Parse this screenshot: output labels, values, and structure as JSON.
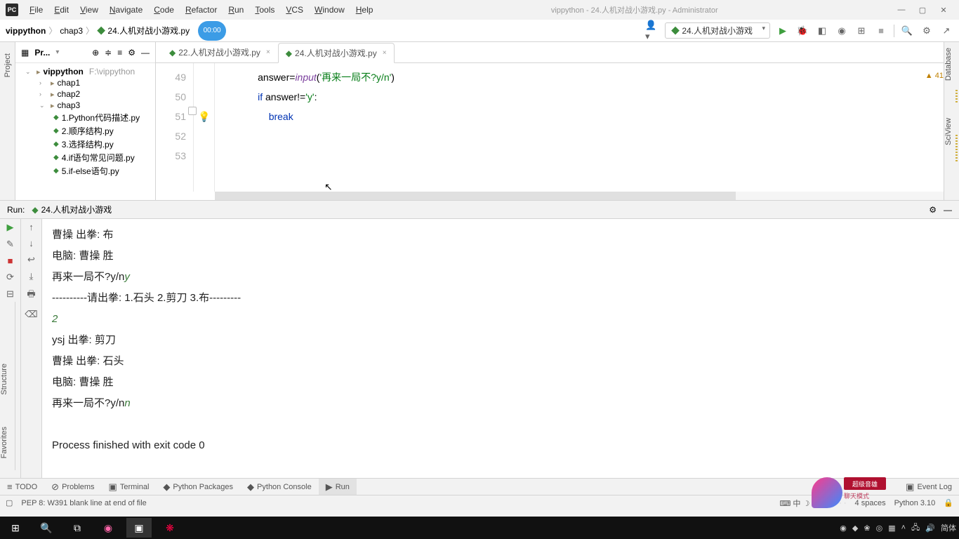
{
  "window": {
    "title": "vippython - 24.人机对战小游戏.py - Administrator",
    "app_icon": "PC"
  },
  "menu": [
    "File",
    "Edit",
    "View",
    "Navigate",
    "Code",
    "Refactor",
    "Run",
    "Tools",
    "VCS",
    "Window",
    "Help"
  ],
  "breadcrumb": [
    "vippython",
    "chap3",
    "24.人机对战小游戏.py"
  ],
  "timer": "00:00",
  "run_config": "24.人机对战小游戏",
  "project": {
    "panel_title": "Pr...",
    "root": "vippython",
    "root_path": "F:\\vippython",
    "folders": [
      "chap1",
      "chap2",
      "chap3"
    ],
    "files": [
      "1.Python代码描述.py",
      "2.顺序结构.py",
      "3.选择结构.py",
      "4.if语句常见问题.py",
      "5.if-else语句.py"
    ]
  },
  "tabs": [
    {
      "name": "22.人机对战小游戏.py",
      "active": false
    },
    {
      "name": "24.人机对战小游戏.py",
      "active": true
    }
  ],
  "code": {
    "lines": [
      {
        "n": 49,
        "indent": "        ",
        "html": "answer=<span class='fn'>input</span>(<span class='str'>'再来一局不?y/n'</span>)"
      },
      {
        "n": 50,
        "indent": "        ",
        "html": "<span class='kw'>if</span> answer!=<span class='str'>'y'</span>:"
      },
      {
        "n": 51,
        "indent": "            ",
        "html": "<span class='kw'>break</span>"
      },
      {
        "n": 52,
        "indent": "",
        "html": "",
        "hl": true
      },
      {
        "n": 53,
        "indent": "",
        "html": ""
      }
    ],
    "warnings": "41"
  },
  "run": {
    "title": "Run:",
    "config": "24.人机对战小游戏",
    "output": [
      {
        "t": "曹操 出拳: 布"
      },
      {
        "t": "电脑:  曹操  胜"
      },
      {
        "t": "再来一局不?y/n",
        "input": "y"
      },
      {
        "t": "----------请出拳:  1.石头   2.剪刀   3.布---------"
      },
      {
        "t": "",
        "input": "2"
      },
      {
        "t": "ysj 出拳: 剪刀"
      },
      {
        "t": "曹操 出拳: 石头"
      },
      {
        "t": "电脑:  曹操  胜"
      },
      {
        "t": "再来一局不?y/n",
        "input": "n"
      },
      {
        "t": ""
      },
      {
        "t": "Process finished with exit code 0"
      }
    ]
  },
  "bottom_tabs": [
    "TODO",
    "Problems",
    "Terminal",
    "Python Packages",
    "Python Console",
    "Run"
  ],
  "bottom_right": "Event Log",
  "status": {
    "msg": "PEP 8: W391 blank line at end of file",
    "right": [
      "4 spaces",
      "Python 3.10"
    ]
  },
  "rails": {
    "left1": "Project",
    "left2": "Structure",
    "left3": "Favorites",
    "right1": "Database",
    "right2": "SciView"
  },
  "badge": {
    "label": "超级音雄",
    "sub": "聊天模式"
  },
  "taskbar_lang": "简体"
}
